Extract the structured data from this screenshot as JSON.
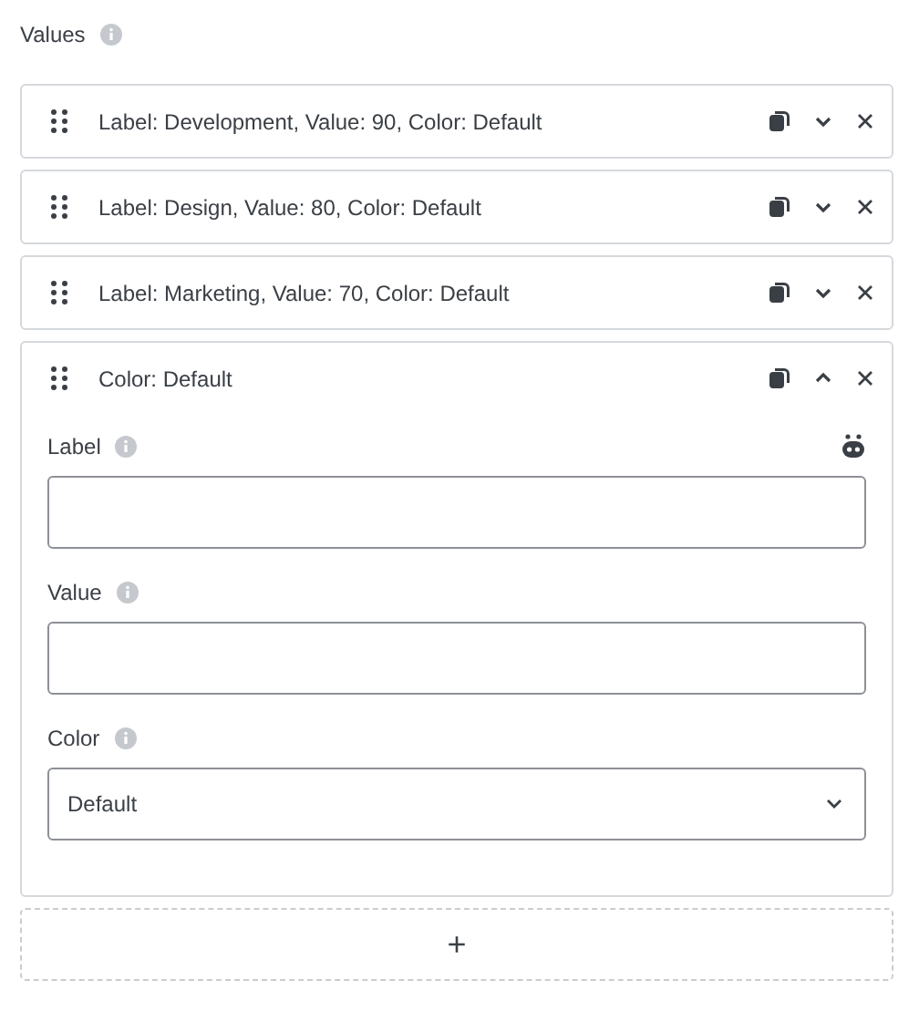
{
  "section_title": "Values",
  "items": [
    {
      "title": "Label: Development, Value: 90, Color: Default",
      "expanded": false
    },
    {
      "title": "Label: Design, Value: 80, Color: Default",
      "expanded": false
    },
    {
      "title": "Label: Marketing, Value: 70, Color: Default",
      "expanded": false
    },
    {
      "title": "Color: Default",
      "expanded": true,
      "fields": [
        {
          "kind": "text",
          "label": "Label",
          "ai": true
        },
        {
          "kind": "text",
          "label": "Value",
          "ai": false
        },
        {
          "kind": "select",
          "label": "Color",
          "value": "Default"
        }
      ]
    }
  ],
  "add_button": "+"
}
